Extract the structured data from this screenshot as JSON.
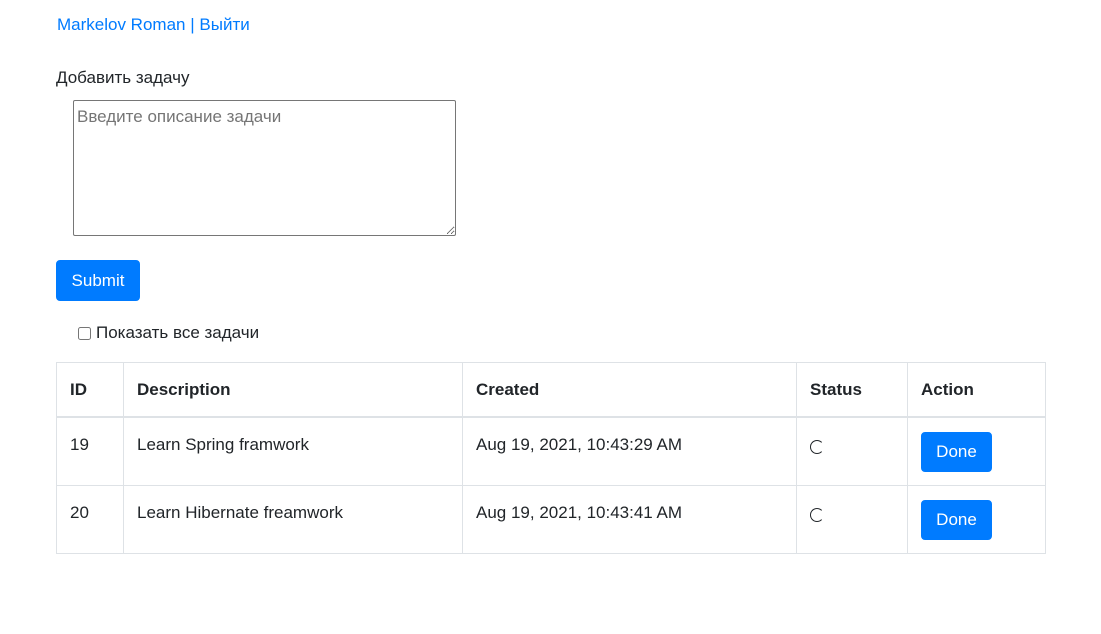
{
  "header": {
    "user_name": "Markelov Roman",
    "separator": "|",
    "logout_label": "Выйти"
  },
  "form": {
    "add_task_label": "Добавить задачу",
    "description_value": "",
    "description_placeholder": "Введите описание задачи",
    "submit_label": "Submit",
    "show_all_label": "Показать все задачи",
    "show_all_checked": false
  },
  "table": {
    "columns": [
      "ID",
      "Description",
      "Created",
      "Status",
      "Action"
    ],
    "rows": [
      {
        "id": "19",
        "description": "Learn Spring framwork",
        "created": "Aug 19, 2021, 10:43:29 AM",
        "status_icon": "spinner-icon",
        "action_label": "Done"
      },
      {
        "id": "20",
        "description": "Learn Hibernate freamwork",
        "created": "Aug 19, 2021, 10:43:41 AM",
        "status_icon": "spinner-icon",
        "action_label": "Done"
      }
    ]
  },
  "colors": {
    "accent": "#007bff",
    "text": "#212529",
    "border": "#dee2e6"
  }
}
